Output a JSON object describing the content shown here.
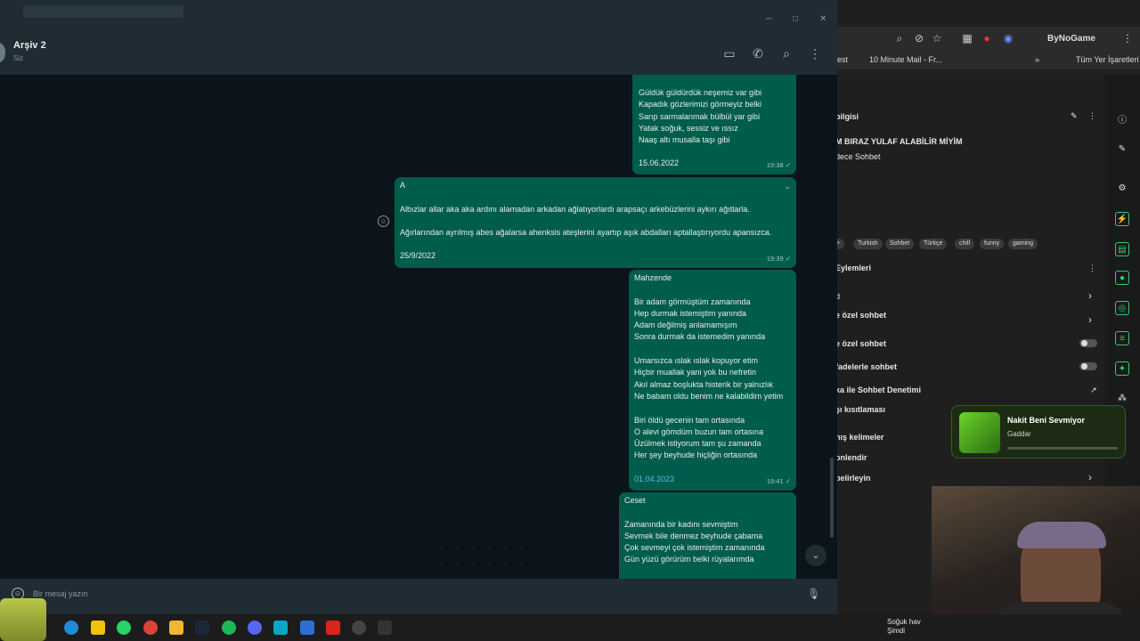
{
  "whatsapp": {
    "chat_name": "Arşiv 2",
    "chat_sub": "Siz",
    "composer_placeholder": "Bir mesaj yazın",
    "messages": [
      {
        "lines": [
          "Güldük güldürdük neşemiz var gibi",
          "Kapadık gözlerimizi görmeyiz belki",
          "Sarıp sarmalanmak bülbül yar gibi",
          "Yatak soğuk, sessiz ve ıssız",
          "Naaş altı musalla taşı gibi"
        ],
        "date": "15.06.2022",
        "time": "19:38 ✓"
      },
      {
        "lines": [
          "A",
          "",
          "Albızlar allar aka aka ardını alamadan arkadan ağlatıyorlardı arapsaçı arkebüzlerini aykırı ağıtlarla.",
          "",
          "Ağırlarından ayrılmış abes ağalarsa ahenksis ateşlerini ayartıp aşık abdalları aptallaştırıyordu apansızca."
        ],
        "date": "25/9/2022",
        "time": "19:39 ✓"
      },
      {
        "lines": [
          "Mahzende",
          "",
          "Bir adam görmüştüm zamanında",
          "Hep durmak istemiştim yanında",
          "Adam değilmiş anlamamışım",
          "Sonra durmak da istemedim yanında",
          "",
          "Umarsızca ıslak ıslak kopuyor etim",
          "Hiçbir muallak yani yok bu nefretin",
          "Akıl almaz boşlukta histerik bir yalnızlık",
          "Ne babam oldu benim ne kalabildim yetim",
          "",
          "Biri öldü gecenin tam ortasında",
          "O alevi gömdüm buzun tam ortasına",
          "Üzülmek istiyorum tam şu zamanda",
          "Her şey beyhude hiçliğin ortasında"
        ],
        "date": "01.04.2023",
        "time": "19:41 ✓"
      },
      {
        "lines": [
          "Ceset",
          "",
          "Zamanında bir kadını sevmiştim",
          "Sevmek bile denmez beyhude çabama",
          "Çok sevmeyi çok istemiştim zamanında",
          "Gün yüzü görürüm belki rüyalarımda"
        ]
      }
    ]
  },
  "browser": {
    "brand": "ByNoGame",
    "bookmarks": [
      "est",
      "10 Minute Mail - Fr...",
      "Tüm Yer İşaretleri"
    ],
    "stream_info_heading": "bilgisi",
    "stream_title": "M BIRAZ YULAF ALABİLİR MİYİM",
    "stream_category": "dece Sohbet",
    "tags": [
      "+",
      "Turkish",
      "Sohbet",
      "Türkçe",
      "chill",
      "funny",
      "gaming"
    ],
    "actions_heading": "Eylemleri",
    "action_items": [
      "d",
      "e özel sohbet",
      "e özel sohbet",
      "fadelerle sohbet",
      "ka ile Sohbet Denetimi",
      "şı kısıtlaması",
      "nış kelimeler",
      "onlendir",
      "belirleyin"
    ]
  },
  "music_widget": {
    "title": "Nakit Beni Sevmiyor",
    "artist": "Gaddar"
  },
  "taskbar": {
    "weather_line1": "Soğuk hav",
    "weather_line2": "Şimdi"
  }
}
